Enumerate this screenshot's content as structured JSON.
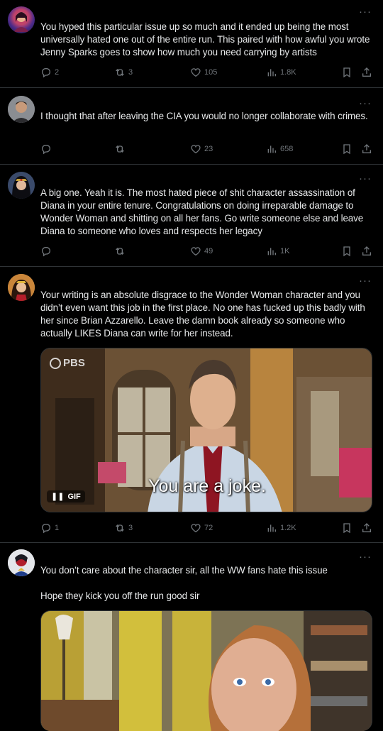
{
  "tweets": [
    {
      "text": "You hyped this particular issue up so much and it ended up being the most universally hated one out of the entire run. This paired with how awful you wrote Jenny Sparks goes to show how much you need carrying by artists",
      "replies": "2",
      "reposts": "3",
      "likes": "105",
      "views": "1.8K"
    },
    {
      "text": "I thought that after leaving the CIA you would no longer collaborate with crimes.",
      "replies": "",
      "reposts": "",
      "likes": "23",
      "views": "658"
    },
    {
      "text": "A big one. Yeah it is. The most hated piece of shit character assassination of Diana in your entire tenure. Congratulations on doing irreparable damage to Wonder Woman and shitting on all her fans. Go write someone else and leave Diana to someone who loves and respects her legacy",
      "replies": "",
      "reposts": "",
      "likes": "49",
      "views": "1K"
    },
    {
      "text": "Your writing is an absolute disgrace to the Wonder Woman character and you didn’t even want this job in the first place. No one has fucked up this badly with her since Brian Azzarello. Leave the damn book already so someone who actually LIKES Diana can write for her instead.",
      "replies": "1",
      "reposts": "3",
      "likes": "72",
      "views": "1.2K",
      "media": {
        "watermark": "PBS",
        "caption": "You are a joke.",
        "badge": "GIF"
      }
    },
    {
      "text": "You don’t care about the character sir, all the WW fans hate this issue\n\nHope they kick you off the run good sir"
    }
  ],
  "colors": {
    "background": "#000000",
    "text": "#e7e9ea",
    "muted": "#71767b",
    "divider": "#2f3336"
  }
}
